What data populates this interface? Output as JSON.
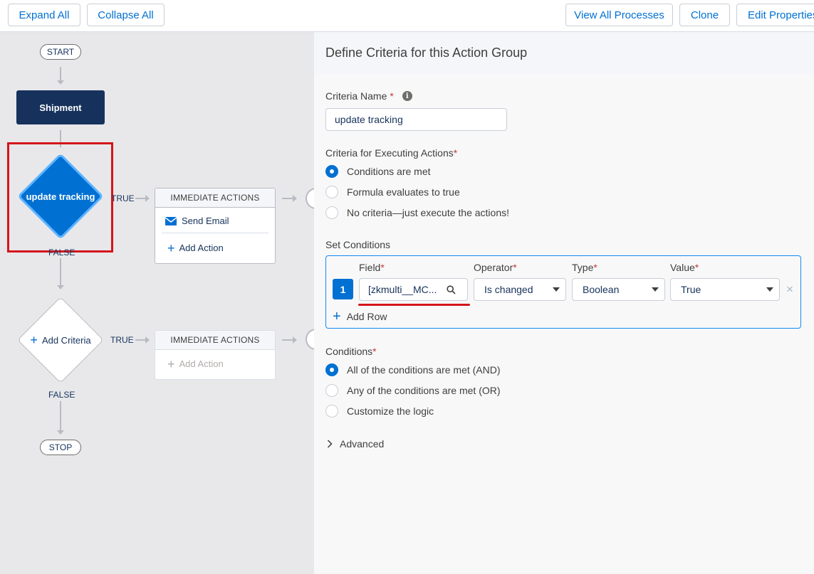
{
  "toolbar": {
    "expand_all": "Expand All",
    "collapse_all": "Collapse All",
    "view_all_processes": "View All Processes",
    "clone": "Clone",
    "edit_properties": "Edit Properties"
  },
  "flow": {
    "start": "START",
    "stop": "STOP",
    "object_node": "Shipment",
    "criteria_node": "update tracking",
    "add_criteria": "Add Criteria",
    "true_label": "TRUE",
    "false_label": "FALSE",
    "immediate_actions": "IMMEDIATE ACTIONS",
    "send_email": "Send Email",
    "add_action": "Add Action"
  },
  "panel": {
    "title": "Define Criteria for this Action Group",
    "criteria_name_label": "Criteria Name",
    "criteria_name_value": "update tracking",
    "executing_label": "Criteria for Executing Actions",
    "executing_options": [
      "Conditions are met",
      "Formula evaluates to true",
      "No criteria—just execute the actions!"
    ],
    "set_conditions_label": "Set Conditions",
    "columns": {
      "field": "Field",
      "operator": "Operator",
      "type": "Type",
      "value": "Value"
    },
    "row": {
      "number": "1",
      "field": "[zkmulti__MC...",
      "operator": "Is changed",
      "type": "Boolean",
      "value": "True"
    },
    "add_row": "Add Row",
    "conditions_label": "Conditions",
    "conditions_options": [
      "All of the conditions are met (AND)",
      "Any of the conditions are met (OR)",
      "Customize the logic"
    ],
    "advanced": "Advanced"
  },
  "colors": {
    "accent": "#0070d2",
    "navy": "#16325c",
    "highlight": "#d3161b"
  }
}
